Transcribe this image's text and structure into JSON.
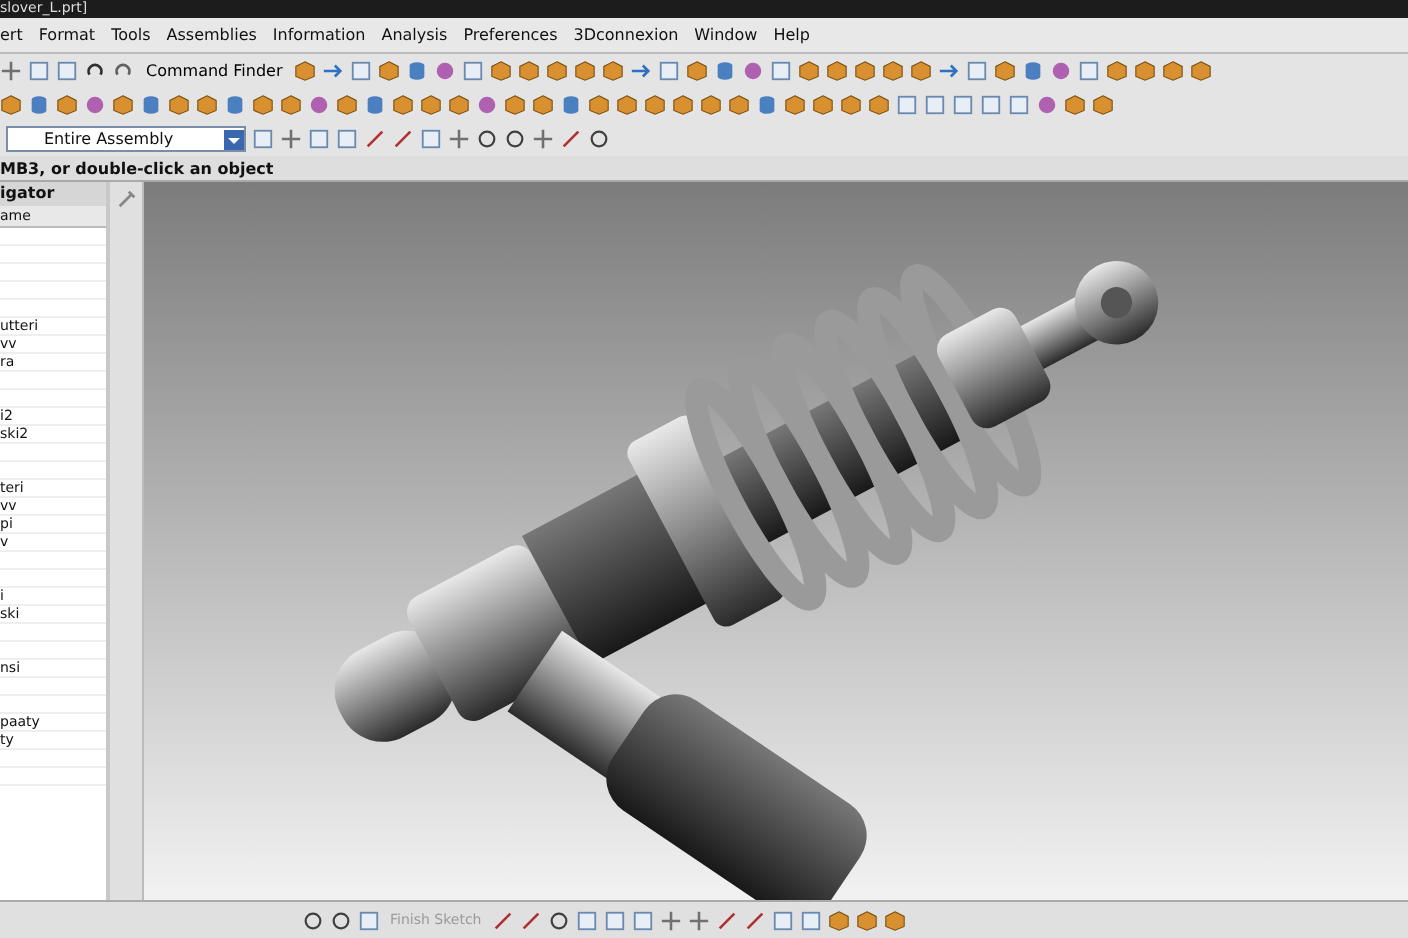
{
  "window": {
    "title": "slover_L.prt]"
  },
  "menu": [
    "ert",
    "Format",
    "Tools",
    "Assemblies",
    "Information",
    "Analysis",
    "Preferences",
    "3Dconnexion",
    "Window",
    "Help"
  ],
  "toolbar": {
    "command_finder": "Command Finder",
    "selection_filter": "Entire Assembly"
  },
  "prompt": "MB3, or double-click an object",
  "navigator": {
    "title": "igator",
    "column": "ame",
    "groups": [
      [
        "utteri",
        "vv",
        "ra"
      ],
      [
        "i2",
        "ski2"
      ],
      [
        "teri",
        "vv",
        "pi",
        "v"
      ],
      [
        "i",
        "ski"
      ],
      [
        "nsi"
      ],
      [
        "paaty",
        "ty"
      ]
    ]
  },
  "sketch_toolbar": {
    "finish_sketch": {
      "label": "Finish Sketch",
      "disabled": true
    }
  }
}
